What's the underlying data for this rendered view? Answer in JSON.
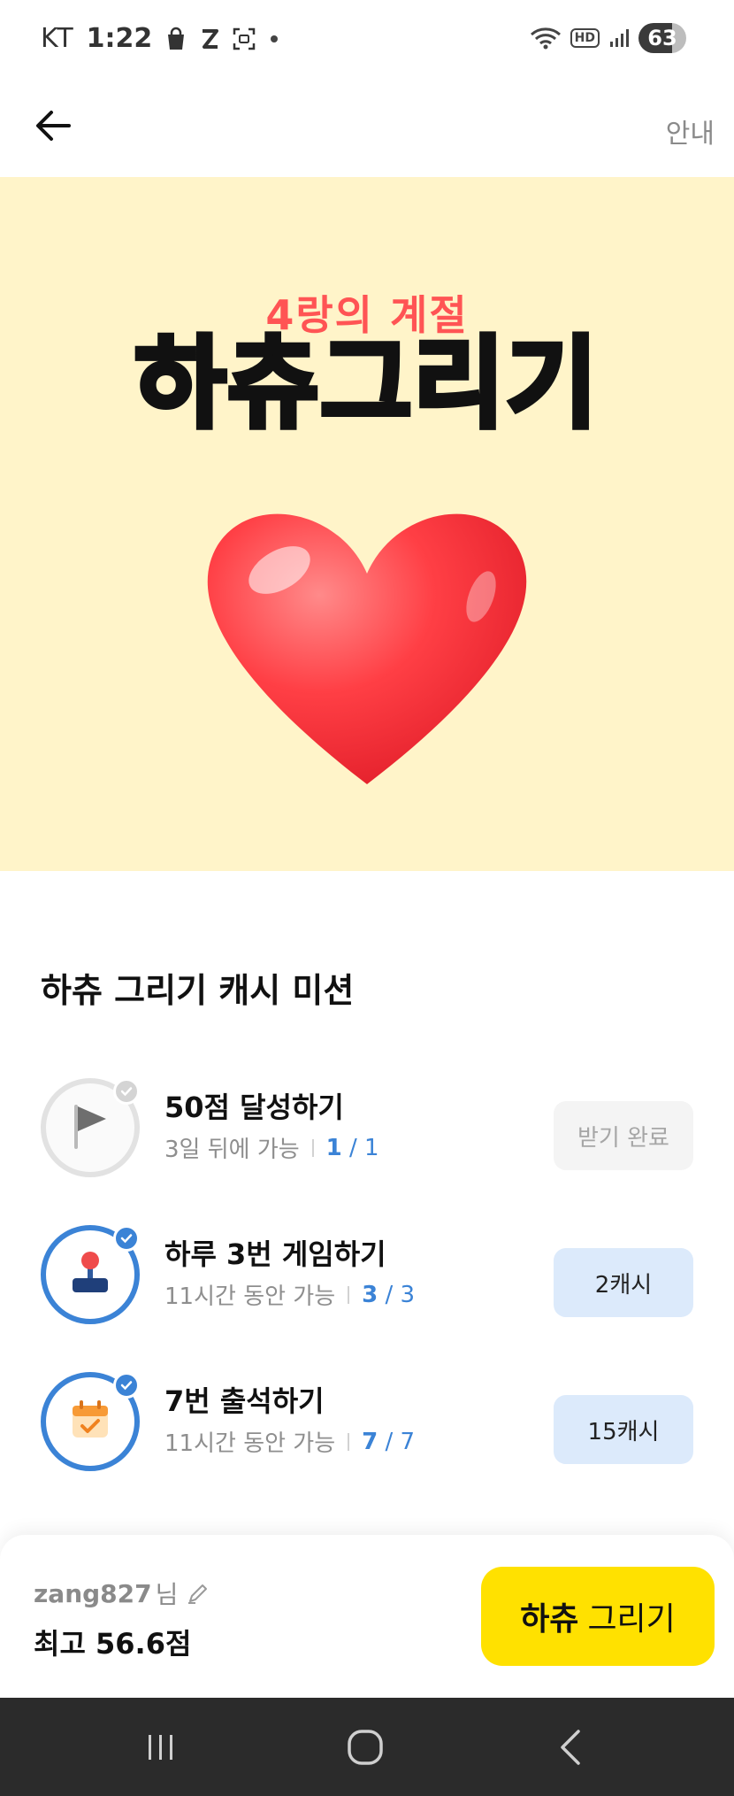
{
  "status_bar": {
    "carrier": "KT",
    "time": "1:22",
    "hd_label": "HD",
    "battery": "63"
  },
  "app_bar": {
    "guide_label": "안내"
  },
  "hero": {
    "subtitle": "4랑의 계절",
    "title": "하츄그리기",
    "background_color": "#fff4c9",
    "subtitle_color": "#ff5454"
  },
  "missions": {
    "section_title": "하츄 그리기 캐시 미션",
    "items": [
      {
        "icon": "flag-icon",
        "title": "50점 달성하기",
        "availability": "3일 뒤에 가능",
        "progress_current": "1",
        "progress_total": "/ 1",
        "button_label": "받기 완료",
        "state": "claimed"
      },
      {
        "icon": "joystick-icon",
        "title": "하루 3번 게임하기",
        "availability": "11시간 동안 가능",
        "progress_current": "3",
        "progress_total": "/ 3",
        "button_label": "2캐시",
        "state": "claimable"
      },
      {
        "icon": "calendar-check-icon",
        "title": "7번 출석하기",
        "availability": "11시간 동안 가능",
        "progress_current": "7",
        "progress_total": "/ 7",
        "button_label": "15캐시",
        "state": "claimable"
      }
    ]
  },
  "bottom": {
    "username": "zang827",
    "username_suffix": "님",
    "best_score": "최고 56.6점",
    "play_button_bold": "하츄",
    "play_button_rest": "그리기",
    "button_color": "#ffe100"
  },
  "colors": {
    "accent_blue": "#3b83d6",
    "claim_button_bg": "#dceafb"
  }
}
